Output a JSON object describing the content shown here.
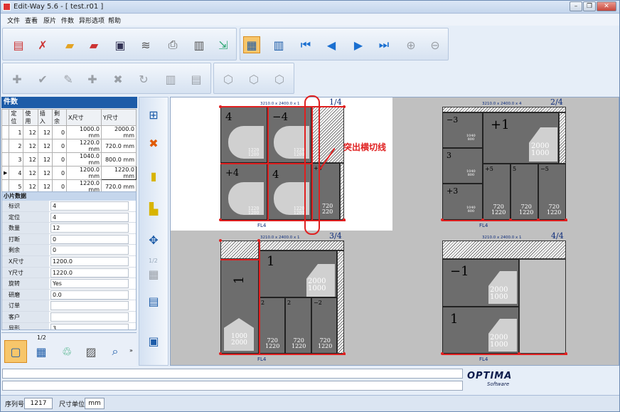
{
  "window": {
    "title": "Edit-Way 5.6 - [ test.r01 ]"
  },
  "menu": [
    "文件",
    "查看",
    "原片",
    "件数",
    "异形选项",
    "帮助"
  ],
  "panel_title": "件数",
  "parts_table": {
    "columns": [
      "定位",
      "使用",
      "插入",
      "剩余",
      "X尺寸",
      "Y尺寸"
    ],
    "rows": [
      [
        "1",
        "12",
        "12",
        "0",
        "1000.0 mm",
        "2000.0 mm"
      ],
      [
        "2",
        "12",
        "12",
        "0",
        "1220.0 mm",
        "720.0 mm"
      ],
      [
        "3",
        "12",
        "12",
        "0",
        "1040.0 mm",
        "800.0 mm"
      ],
      [
        "4",
        "12",
        "12",
        "0",
        "1200.0 mm",
        "1220.0 mm"
      ],
      [
        "5",
        "12",
        "12",
        "0",
        "1220.0 mm",
        "720.0 mm"
      ]
    ]
  },
  "piece_data": {
    "title": "小片数据",
    "fields": [
      {
        "key": "标识",
        "value": "4"
      },
      {
        "key": "定位",
        "value": "4"
      },
      {
        "key": "数量",
        "value": "12"
      },
      {
        "key": "打断",
        "value": "0"
      },
      {
        "key": "剩余",
        "value": "0"
      },
      {
        "key": "X尺寸",
        "value": "1200.0"
      },
      {
        "key": "Y尺寸",
        "value": "1220.0"
      },
      {
        "key": "旋转",
        "value": "Yes"
      },
      {
        "key": "研磨",
        "value": "0.0"
      },
      {
        "key": "订单",
        "value": ""
      },
      {
        "key": "客户",
        "value": ""
      },
      {
        "key": "异形",
        "value": "3"
      }
    ]
  },
  "nav_half_label": "1/2",
  "vtool_half_label": "1/2",
  "sheets": [
    {
      "page": "1/4",
      "dims": "3210.0 x 2400.0 x 1",
      "fl": "FL4"
    },
    {
      "page": "2/4",
      "dims": "3210.0 x 2400.0 x 4",
      "fl": "FL4"
    },
    {
      "page": "3/4",
      "dims": "3210.0 x 2400.0 x 1",
      "fl": "FL4"
    },
    {
      "page": "4/4",
      "dims": "3210.0 x 2400.0 x 1",
      "fl": "FL4"
    }
  ],
  "annotation": "突出横切线",
  "logo_text": "OPTIMA",
  "logo_sub": "Software",
  "status": {
    "serial_label": "序列号",
    "serial_value": "1217",
    "unit_label": "尺寸单位",
    "unit_value": "mm"
  },
  "colors": {
    "accent": "#1d5ca8",
    "cut_line": "#e02020",
    "piece_fill": "#6d6d6d"
  }
}
